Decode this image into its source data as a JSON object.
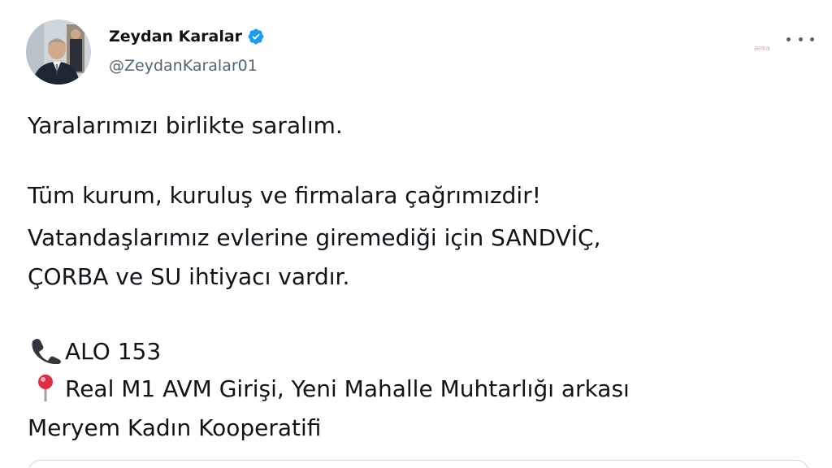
{
  "author": {
    "display_name": "Zeydan Karalar",
    "handle": "@ZeydanKaralar01",
    "verified": true
  },
  "watermark": "anka",
  "tweet": {
    "line1": "Yaralarımızı birlikte saralım.",
    "line2": "Tüm kurum, kuruluş ve firmalara çağrımızdir!",
    "line3": "Vatandaşlarımız evlerine giremediği için SANDVİÇ,",
    "line4": "ÇORBA ve SU ihtiyacı vardır.",
    "phone_line": "ALO 153",
    "location_line": "Real M1 AVM Girişi, Yeni Mahalle Muhtarlığı arkası",
    "last_line": "Meryem Kadın Kooperatifi"
  },
  "icons": {
    "verified": "verified-badge-icon",
    "more": "more-icon",
    "phone": "telephone-receiver-icon",
    "pin": "round-pushpin-icon"
  },
  "colors": {
    "text": "#0f1419",
    "secondary": "#536471",
    "verified": "#1d9bf0"
  }
}
